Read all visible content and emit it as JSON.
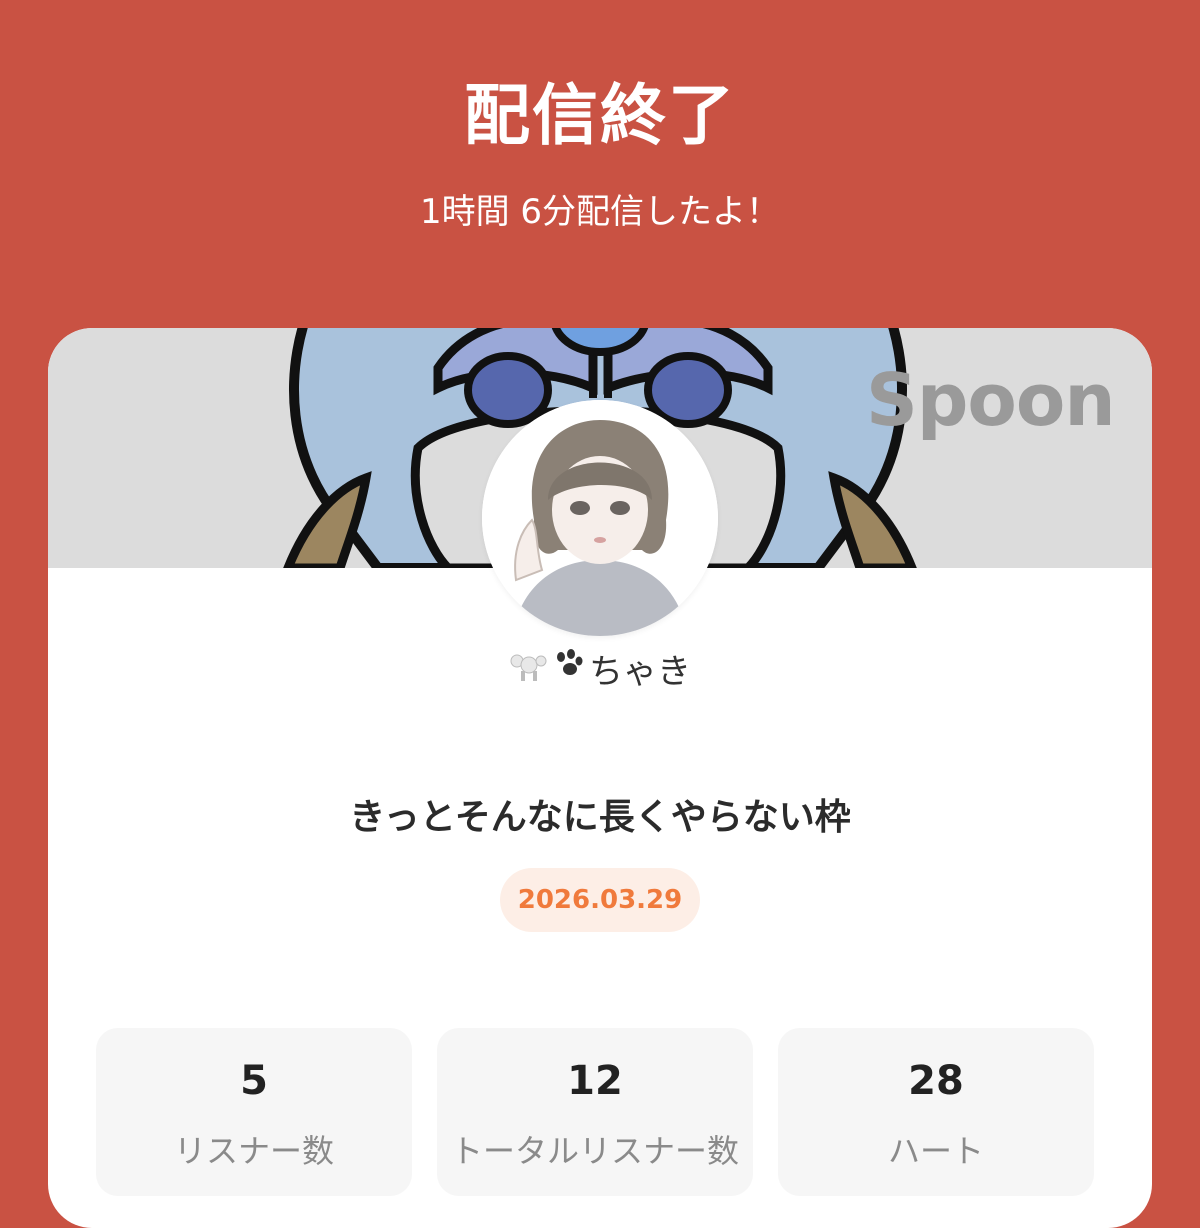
{
  "header": {
    "title": "配信終了",
    "subtitle": "1時間 6分配信したよ！"
  },
  "banner": {
    "logo_text": "Spoon"
  },
  "profile": {
    "username": "ちゃき",
    "name_icons": [
      "poodle-icon",
      "paw-icon"
    ]
  },
  "live": {
    "title": "きっとそんなに長くやらない枠",
    "date": "2026.03.29"
  },
  "stats": [
    {
      "value": "5",
      "label": "リスナー数"
    },
    {
      "value": "12",
      "label": "トータルリスナー数"
    },
    {
      "value": "28",
      "label": "ハート"
    }
  ],
  "colors": {
    "background": "#c95243",
    "card": "#ffffff",
    "banner": "#dcdcdc",
    "date_badge_bg": "#fdeee6",
    "date_badge_text": "#f07a3c",
    "stat_card": "#f6f6f6"
  }
}
